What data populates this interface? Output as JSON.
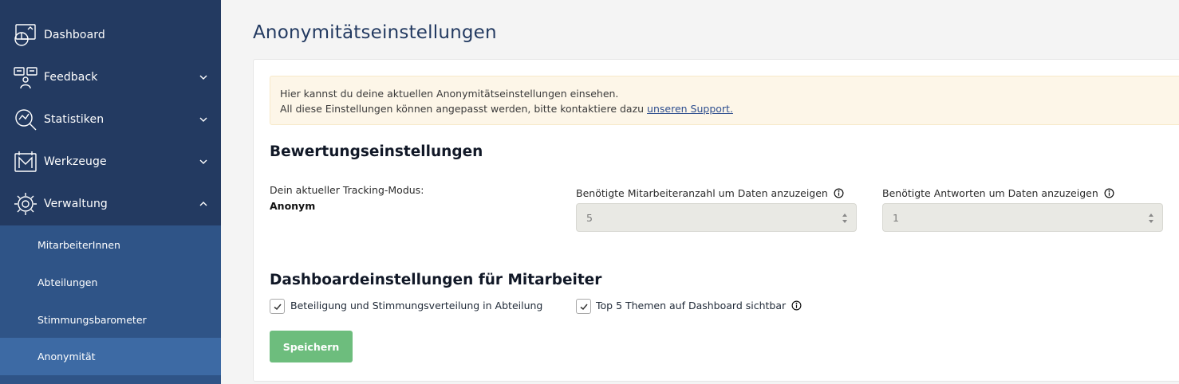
{
  "sidebar": {
    "items": [
      {
        "label": "Dashboard",
        "icon": "dashboard-icon"
      },
      {
        "label": "Feedback",
        "icon": "feedback-icon"
      },
      {
        "label": "Statistiken",
        "icon": "statistics-icon"
      },
      {
        "label": "Werkzeuge",
        "icon": "tools-icon"
      },
      {
        "label": "Verwaltung",
        "icon": "settings-gear-icon"
      }
    ],
    "submenu": [
      {
        "label": "MitarbeiterInnen"
      },
      {
        "label": "Abteilungen"
      },
      {
        "label": "Stimmungsbarometer"
      },
      {
        "label": "Anonymität",
        "active": true
      }
    ]
  },
  "main": {
    "title": "Anonymitätseinstellungen",
    "notice": {
      "line1": "Hier kannst du deine aktuellen Anonymitätseinstellungen einsehen.",
      "line2_prefix": "All diese Einstellungen können angepasst werden, bitte kontaktiere dazu ",
      "line2_link": "unseren Support."
    },
    "rating": {
      "heading": "Bewertungseinstellungen",
      "tracking_label": "Dein aktueller Tracking-Modus:",
      "tracking_value": "Anonym",
      "min_employees_label": "Benötigte Mitarbeiteranzahl um Daten anzuzeigen",
      "min_employees_value": "5",
      "min_answers_label": "Benötigte Antworten um Daten anzuzeigen",
      "min_answers_value": "1"
    },
    "dashboard": {
      "heading": "Dashboardeinstellungen für Mitarbeiter",
      "option1_label": "Beteiligung und Stimmungsverteilung in Abteilung",
      "option1_checked": true,
      "option2_label": "Top 5 Themen auf Dashboard sichtbar",
      "option2_checked": true
    },
    "save_label": "Speichern"
  },
  "colors": {
    "sidebar_bg": "#233a61",
    "submenu_bg": "#2f5487",
    "submenu_active": "#3d6aa4",
    "save_button": "#6dbd7d",
    "notice_bg": "#fdf6e8"
  }
}
